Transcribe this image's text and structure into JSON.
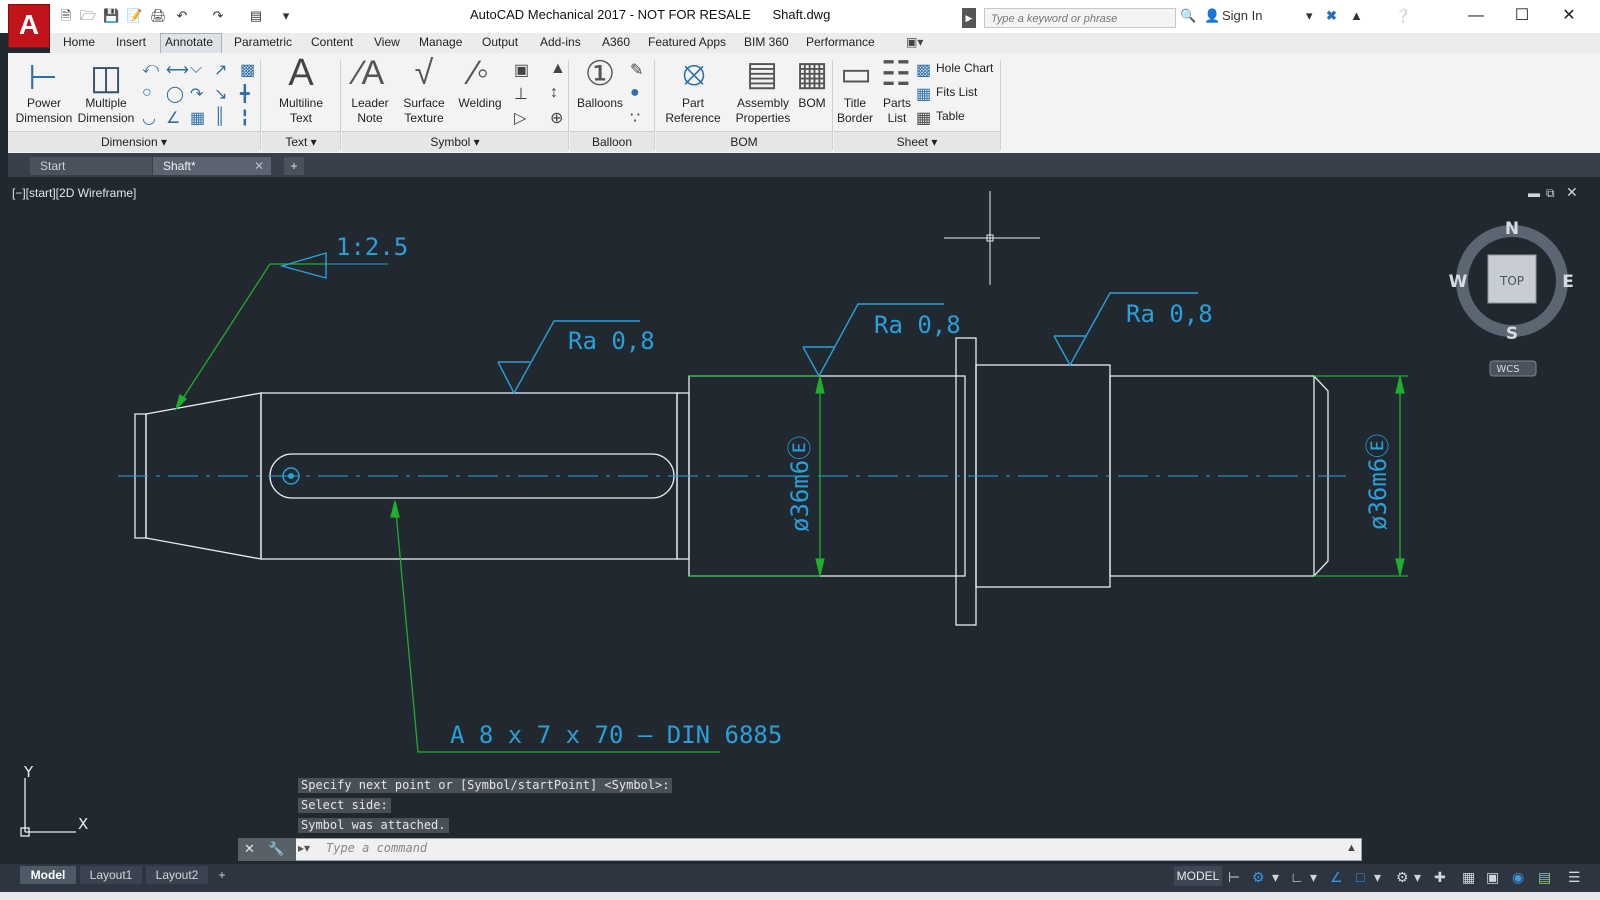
{
  "titlebar": {
    "title": "AutoCAD Mechanical 2017 - NOT FOR RESALE      Shaft.dwg",
    "search_placeholder": "Type a keyword or phrase",
    "sign_in": "Sign In",
    "logo": "A"
  },
  "ribbon_tabs": [
    "Home",
    "Insert",
    "Annotate",
    "Parametric",
    "Content",
    "View",
    "Manage",
    "Output",
    "Add-ins",
    "A360",
    "Featured Apps",
    "BIM 360",
    "Performance"
  ],
  "ribbon": {
    "power_dimension": "Power\nDimension",
    "multiple_dimension": "Multiple\nDimension",
    "multiline_text": "Multiline\nText",
    "leader_note": "Leader\nNote",
    "surface_texture": "Surface\nTexture",
    "welding": "Welding",
    "balloons": "Balloons",
    "part_reference": "Part\nReference",
    "assembly_properties": "Assembly\nProperties",
    "bom": "BOM",
    "title_border": "Title\nBorder",
    "parts_list": "Parts\nList",
    "hole_chart": "Hole Chart",
    "fits_list": "Fits List",
    "table": "Table",
    "panels": [
      "Dimension",
      "Text",
      "Symbol",
      "Balloon",
      "BOM",
      "Sheet"
    ]
  },
  "doc_tabs": {
    "start": "Start",
    "shaft": "Shaft*",
    "new": "+"
  },
  "viewport": {
    "label": "[−][start][2D Wireframe]",
    "viewcube": {
      "top": "TOP",
      "n": "N",
      "s": "S",
      "e": "E",
      "w": "W",
      "wcs": "WCS"
    }
  },
  "annotations": {
    "taper": "1:2.5",
    "ra1": "Ra 0,8",
    "ra2": "Ra 0,8",
    "ra3": "Ra 0,8",
    "dim1": "ø36m6Ⓔ",
    "dim2": "ø36m6Ⓔ",
    "key": "A 8 x 7 x 70 – DIN 6885"
  },
  "ucs": {
    "x": "X",
    "y": "Y"
  },
  "command_history": [
    "Specify next point or [Symbol/startPoint] <Symbol>:",
    "Select side:",
    "Symbol was attached."
  ],
  "command_placeholder": "Type a command",
  "layout_tabs": [
    "Model",
    "Layout1",
    "Layout2",
    "+"
  ],
  "status": {
    "model": "MODEL"
  },
  "colors": {
    "background": "#212830",
    "geometry": "#e8edf2",
    "annotation": "#2a9fd8",
    "leader": "#1fae2e",
    "accent": "#c0141b"
  }
}
